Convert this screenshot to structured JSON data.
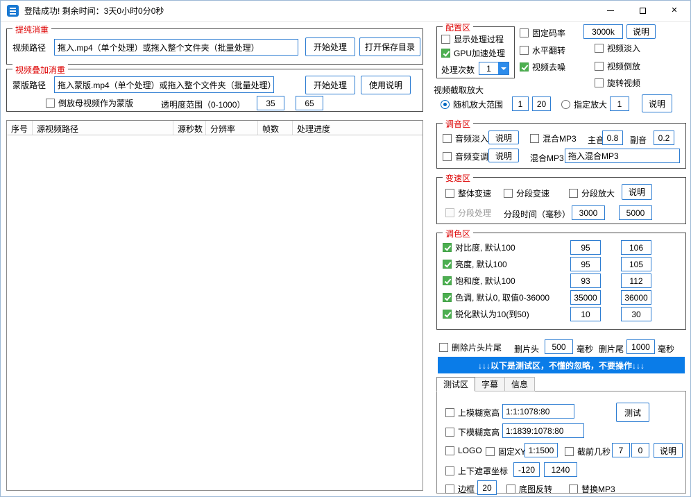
{
  "window": {
    "title": "登陆成功! 剩余时间：3天0小时0分0秒"
  },
  "icons": {
    "close": "✕"
  },
  "purify": {
    "title": "提纯消重",
    "path_label": "视频路径",
    "path_value": "拖入.mp4（单个处理）或拖入整个文件夹（批量处理）",
    "start": "开始处理",
    "open_dir": "打开保存目录"
  },
  "overlay": {
    "title": "视频叠加消重",
    "mask_label": "蒙版路径",
    "mask_value": "拖入蒙版.mp4（单个处理）或拖入整个文件夹（批量处理）",
    "start": "开始处理",
    "usage": "使用说明",
    "reverse_mother": "倒放母视频作为蒙版",
    "opacity_label": "透明度范围（0-1000）",
    "opacity_min": "35",
    "opacity_max": "65"
  },
  "table": {
    "headers": [
      "序号",
      "源视频路径",
      "源秒数",
      "分辨率",
      "帧数",
      "处理进度"
    ]
  },
  "config": {
    "title": "配置区",
    "show_process": "显示处理过程",
    "gpu": "GPU加速处理",
    "times_label": "处理次数",
    "times_value": "1",
    "fixed_bitrate": "固定码率",
    "bitrate_value": "3000k",
    "bitrate_help": "说明",
    "hflip": "水平翻转",
    "denoise": "视频去噪",
    "fade_in": "视频淡入",
    "reverse": "视频倒放",
    "rotate": "旋转视频"
  },
  "crop": {
    "title": "视频截取放大",
    "random_label": "随机放大范围",
    "random_min": "1",
    "random_max": "20",
    "fixed_label": "指定放大",
    "fixed_value": "1",
    "help": "说明"
  },
  "audio": {
    "title": "调音区",
    "fade_in": "音频淡入",
    "fade_help": "说明",
    "mix": "混合MP3",
    "main_label": "主音",
    "main_value": "0.8",
    "sub_label": "副音",
    "sub_value": "0.2",
    "pitch": "音频变调",
    "pitch_help": "说明",
    "mix_label": "混合MP3",
    "mix_value": "拖入混合MP3"
  },
  "speed": {
    "title": "变速区",
    "overall": "整体变速",
    "segmented": "分段变速",
    "segment_zoom": "分段放大",
    "help": "说明",
    "segment_process": "分段处理",
    "segment_time": "分段时间（毫秒）",
    "time_min": "3000",
    "time_max": "5000"
  },
  "color": {
    "title": "调色区",
    "rows": [
      {
        "label": "对比度, 默认100",
        "v1": "95",
        "v2": "106"
      },
      {
        "label": "亮度, 默认100",
        "v1": "95",
        "v2": "105"
      },
      {
        "label": "饱和度, 默认100",
        "v1": "93",
        "v2": "112"
      },
      {
        "label": "色调, 默认0, 取值0-36000",
        "v1": "35000",
        "v2": "36000"
      },
      {
        "label": "锐化默认为10(到50)",
        "v1": "10",
        "v2": "30"
      }
    ]
  },
  "trim": {
    "label": "删除片头片尾",
    "head_label": "删片头",
    "head_value": "500",
    "head_unit": "毫秒",
    "tail_label": "删片尾",
    "tail_value": "1000",
    "tail_unit": "毫秒"
  },
  "banner": {
    "text": "↓↓↓以下是测试区，不懂的忽略，不要操作↓↓↓"
  },
  "tabs": [
    {
      "label": "测试区"
    },
    {
      "label": "字幕"
    },
    {
      "label": "信息"
    }
  ],
  "test": {
    "top_blur": "上模糊宽高",
    "top_blur_value": "1:1:1078:80",
    "test_btn": "测试",
    "bottom_blur": "下模糊宽高",
    "bottom_blur_value": "1:1839:1078:80",
    "logo": "LOGO",
    "fixed_xy": "固定XY",
    "fixed_xy_value": "1:1500",
    "cut_first": "截前几秒",
    "cut_v1": "7",
    "cut_v2": "0",
    "help": "说明",
    "mask_xy": "上下遮罩坐标",
    "mask_v1": "-120",
    "mask_v2": "1240",
    "border": "边框",
    "border_value": "20",
    "invert": "底图反转",
    "replace_mp3": "替换MP3"
  },
  "colors": {
    "accent": "#0a7ce8",
    "group_title_red": "#dd0000",
    "checked_green": "#4caf50"
  }
}
